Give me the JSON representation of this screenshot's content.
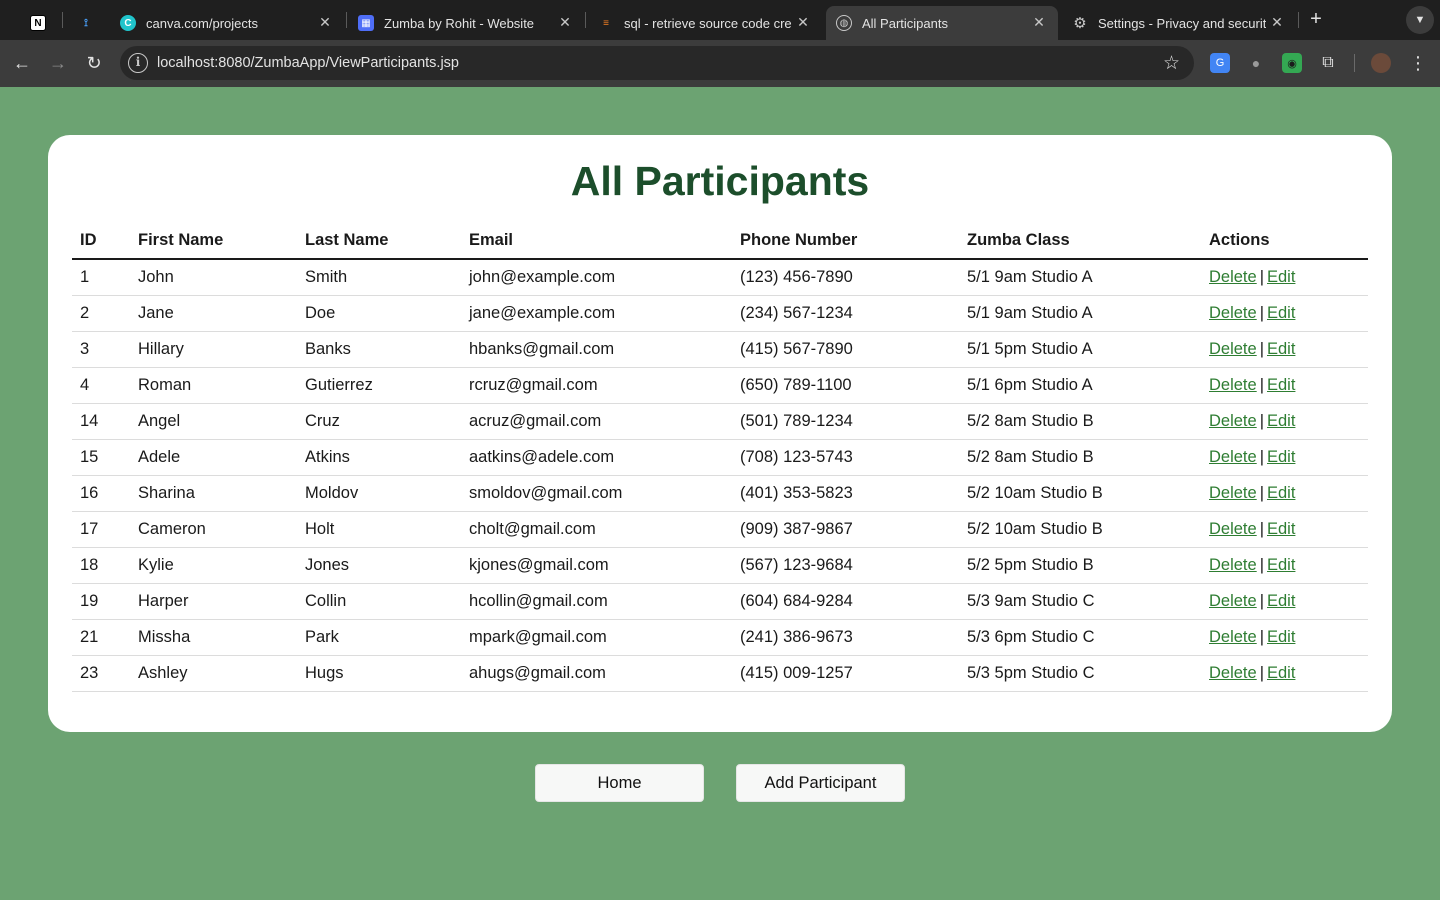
{
  "browser": {
    "tabs": [
      {
        "title": "",
        "favicon": "notion-icon"
      },
      {
        "title": "",
        "favicon": "app-icon"
      },
      {
        "title": "canva.com/projects",
        "favicon": "canva-icon"
      },
      {
        "title": "Zumba by Rohit - Website",
        "favicon": "calendar-icon"
      },
      {
        "title": "sql - retrieve source code cre",
        "favicon": "stackoverflow-icon"
      },
      {
        "title": "All Participants",
        "favicon": "globe-icon"
      },
      {
        "title": "Settings - Privacy and securit",
        "favicon": "gear-icon"
      }
    ],
    "url": "localhost:8080/ZumbaApp/ViewParticipants.jsp"
  },
  "page": {
    "title": "All Participants",
    "columns": [
      "ID",
      "First Name",
      "Last Name",
      "Email",
      "Phone Number",
      "Zumba Class",
      "Actions"
    ],
    "rows": [
      {
        "id": "1",
        "first": "John",
        "last": "Smith",
        "email": "john@example.com",
        "phone": "(123) 456-7890",
        "cls": "5/1 9am Studio A"
      },
      {
        "id": "2",
        "first": "Jane",
        "last": "Doe",
        "email": "jane@example.com",
        "phone": "(234) 567-1234",
        "cls": "5/1 9am Studio A"
      },
      {
        "id": "3",
        "first": "Hillary",
        "last": "Banks",
        "email": "hbanks@gmail.com",
        "phone": "(415) 567-7890",
        "cls": "5/1 5pm Studio A"
      },
      {
        "id": "4",
        "first": "Roman",
        "last": "Gutierrez",
        "email": "rcruz@gmail.com",
        "phone": "(650) 789-1100",
        "cls": "5/1 6pm Studio A"
      },
      {
        "id": "14",
        "first": "Angel",
        "last": "Cruz",
        "email": "acruz@gmail.com",
        "phone": "(501) 789-1234",
        "cls": "5/2 8am Studio B"
      },
      {
        "id": "15",
        "first": "Adele",
        "last": "Atkins",
        "email": "aatkins@adele.com",
        "phone": "(708) 123-5743",
        "cls": "5/2 8am Studio B"
      },
      {
        "id": "16",
        "first": "Sharina",
        "last": "Moldov",
        "email": "smoldov@gmail.com",
        "phone": "(401) 353-5823",
        "cls": "5/2 10am Studio B"
      },
      {
        "id": "17",
        "first": "Cameron",
        "last": "Holt",
        "email": "cholt@gmail.com",
        "phone": "(909) 387-9867",
        "cls": "5/2 10am Studio B"
      },
      {
        "id": "18",
        "first": "Kylie",
        "last": "Jones",
        "email": "kjones@gmail.com",
        "phone": "(567) 123-9684",
        "cls": "5/2 5pm Studio B"
      },
      {
        "id": "19",
        "first": "Harper",
        "last": "Collin",
        "email": "hcollin@gmail.com",
        "phone": "(604) 684-9284",
        "cls": "5/3 9am Studio C"
      },
      {
        "id": "21",
        "first": "Missha",
        "last": "Park",
        "email": "mpark@gmail.com",
        "phone": "(241) 386-9673",
        "cls": "5/3 6pm Studio C"
      },
      {
        "id": "23",
        "first": "Ashley",
        "last": "Hugs",
        "email": "ahugs@gmail.com",
        "phone": "(415) 009-1257",
        "cls": "5/3 5pm Studio C"
      }
    ],
    "delete_label": "Delete",
    "edit_label": "Edit",
    "separator": "|",
    "home_label": "Home",
    "add_label": "Add Participant"
  },
  "colors": {
    "page_bg": "#6ca372",
    "title": "#1c4e2b",
    "link": "#2e7d32"
  }
}
